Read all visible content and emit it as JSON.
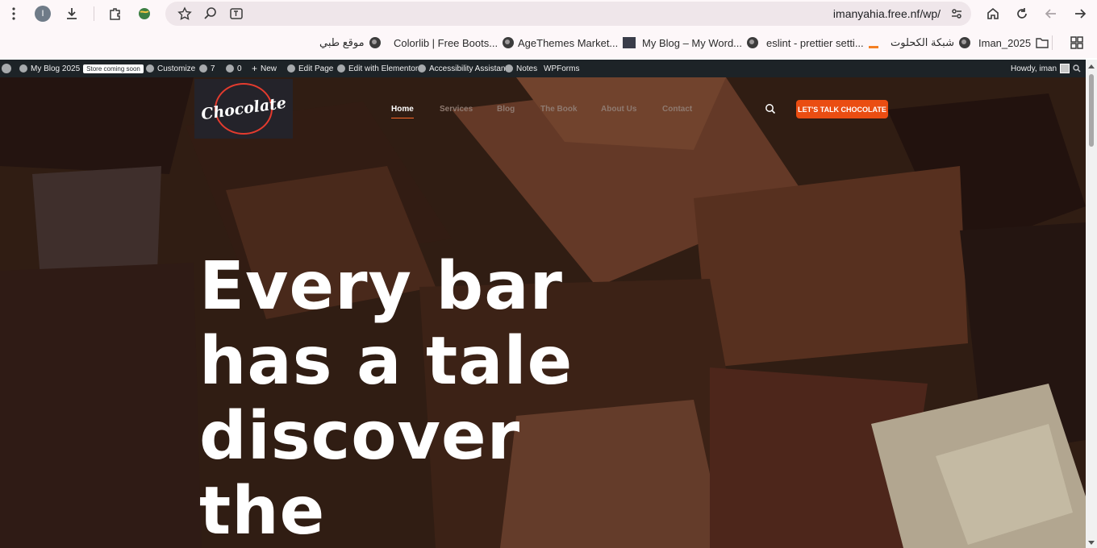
{
  "browser": {
    "profile_initial": "I",
    "url": "imanyahia.free.nf/wp/"
  },
  "bookmarks": [
    {
      "label": "موقع طبي",
      "icon": "globe-icon"
    },
    {
      "label": "Colorlib | Free Boots...",
      "icon": "globe-icon"
    },
    {
      "label": "AgeThemes Market...",
      "icon": "globe-icon"
    },
    {
      "label": "My Blog – My Word...",
      "icon": "site-icon"
    },
    {
      "label": "eslint - prettier setti...",
      "icon": "globe-icon"
    },
    {
      "label": "شبكة الكحلوت",
      "icon": "stackoverflow-icon"
    },
    {
      "label": "Iman_2025",
      "icon": "globe-icon"
    }
  ],
  "adminbar": {
    "site": "My Blog 2025",
    "badge": "Store coming soon",
    "customize": "Customize",
    "updates": "7",
    "comments": "0",
    "new": "New",
    "edit_page": "Edit Page",
    "elementor": "Edit with Elementor",
    "accessibility": "Accessibility Assistant",
    "notes": "Notes",
    "wpforms": "WPForms",
    "howdy": "Howdy, iman"
  },
  "site": {
    "logo_text": "Chocolate",
    "nav": [
      "Home",
      "Services",
      "Blog",
      "The Book",
      "About Us",
      "Contact"
    ],
    "cta": "LET'S TALK CHOCOLATE",
    "headline": [
      "Every bar",
      "has a tale",
      "discover",
      "the"
    ]
  },
  "colors": {
    "accent": "#ea4d12",
    "adminbar": "#1d2327",
    "browser_bg": "#fdf7f9"
  }
}
